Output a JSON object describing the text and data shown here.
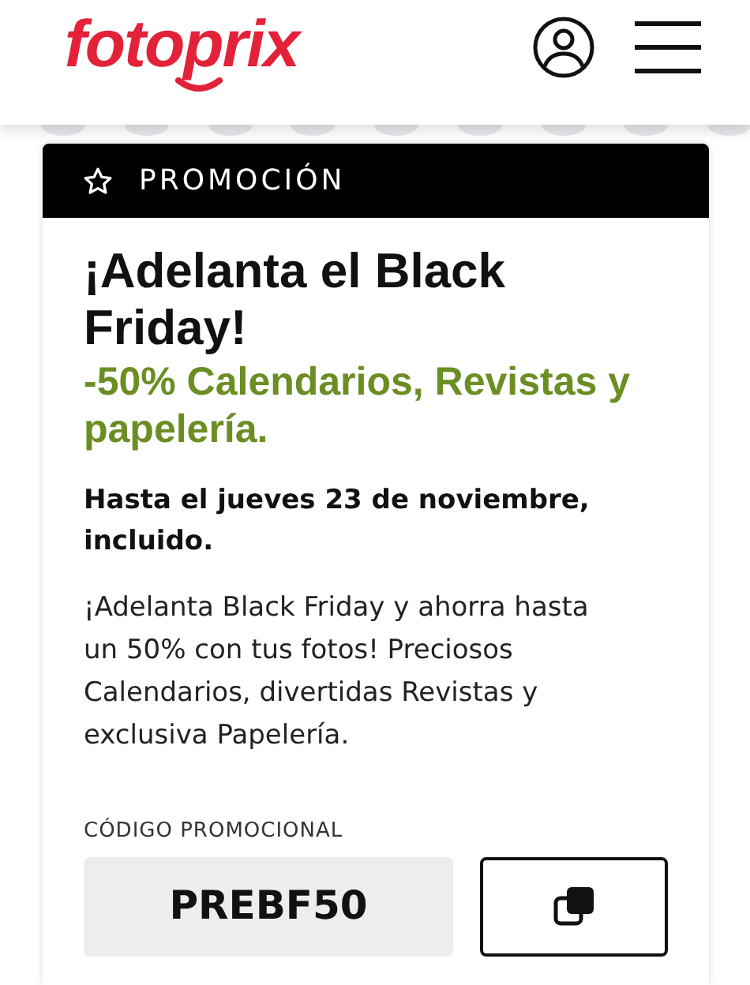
{
  "header": {
    "logo": "fotoprix"
  },
  "promo": {
    "badge": "PROMOCIÓN",
    "title": "¡Adelanta el Black Friday!",
    "subtitle": "-50% Calendarios, Revistas y papelería.",
    "deadline": "Hasta el jueves 23 de noviembre, incluido.",
    "description": "¡Adelanta Black Friday y ahorra hasta un 50% con tus fotos! Preciosos Calendarios, divertidas Revistas y exclusiva Papelería.",
    "code_label": "CÓDIGO PROMOCIONAL",
    "code": "PREBF50"
  }
}
